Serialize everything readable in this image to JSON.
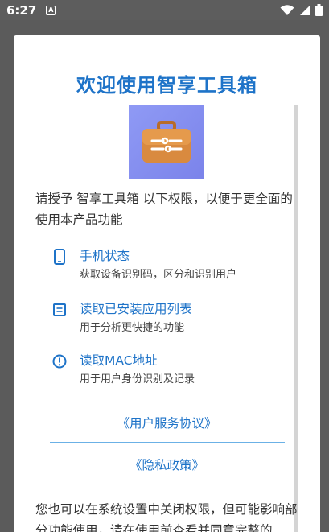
{
  "status_bar": {
    "time": "6:27",
    "notification_icon": "a-icon",
    "right_icons": [
      "wifi-icon",
      "signal-icon",
      "battery-icon"
    ]
  },
  "dialog": {
    "title": "欢迎使用智享工具箱",
    "app_icon": "toolbox-icon",
    "intro": "请授予 智享工具箱 以下权限，以便于更全面的使用本产品功能",
    "permissions": [
      {
        "icon": "phone-icon",
        "title": "手机状态",
        "desc": "获取设备识别码，区分和识别用户"
      },
      {
        "icon": "list-icon",
        "title": "读取已安装应用列表",
        "desc": "用于分析更快捷的功能"
      },
      {
        "icon": "info-icon",
        "title": "读取MAC地址",
        "desc": "用于用户身份识别及记录"
      }
    ],
    "user_agreement_link": "《用户服务协议》",
    "privacy_policy_link": "《隐私政策》",
    "footer": "您也可以在系统设置中关闭权限，但可能影响部分功能使用，请在使用前查看并同意完整的"
  },
  "colors": {
    "accent": "#1e73c8",
    "icon_bg": "#8f9af5",
    "toolbox": "#d98a3f"
  }
}
